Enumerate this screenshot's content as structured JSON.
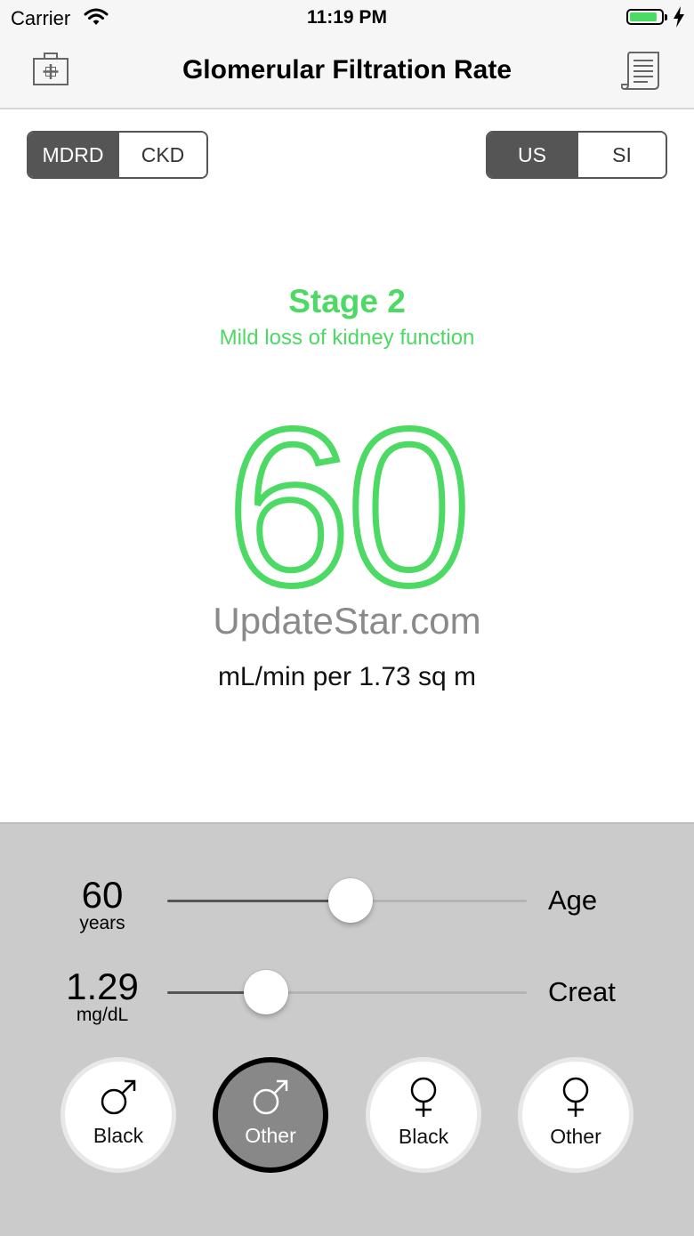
{
  "status_bar": {
    "carrier": "Carrier",
    "time": "11:19 PM"
  },
  "nav": {
    "title": "Glomerular Filtration Rate",
    "left_icon": "medical-kit-icon",
    "right_icon": "report-icon"
  },
  "formula_toggle": {
    "options": [
      "MDRD",
      "CKD"
    ],
    "selected": "MDRD"
  },
  "units_toggle": {
    "options": [
      "US",
      "SI"
    ],
    "selected": "US"
  },
  "result": {
    "stage": "Stage 2",
    "description": "Mild loss of kidney function",
    "value": "60",
    "unit": "mL/min per 1.73 sq m",
    "watermark": "UpdateStar.com",
    "color": "#4cd964"
  },
  "sliders": {
    "age": {
      "value": "60",
      "unit": "years",
      "label": "Age",
      "level": 0.51
    },
    "creat": {
      "value": "1.29",
      "unit": "mg/dL",
      "label": "Creat",
      "level": 0.275
    }
  },
  "demographics": [
    {
      "sex": "male",
      "label": "Black",
      "selected": false
    },
    {
      "sex": "male",
      "label": "Other",
      "selected": true
    },
    {
      "sex": "female",
      "label": "Black",
      "selected": false
    },
    {
      "sex": "female",
      "label": "Other",
      "selected": false
    }
  ]
}
